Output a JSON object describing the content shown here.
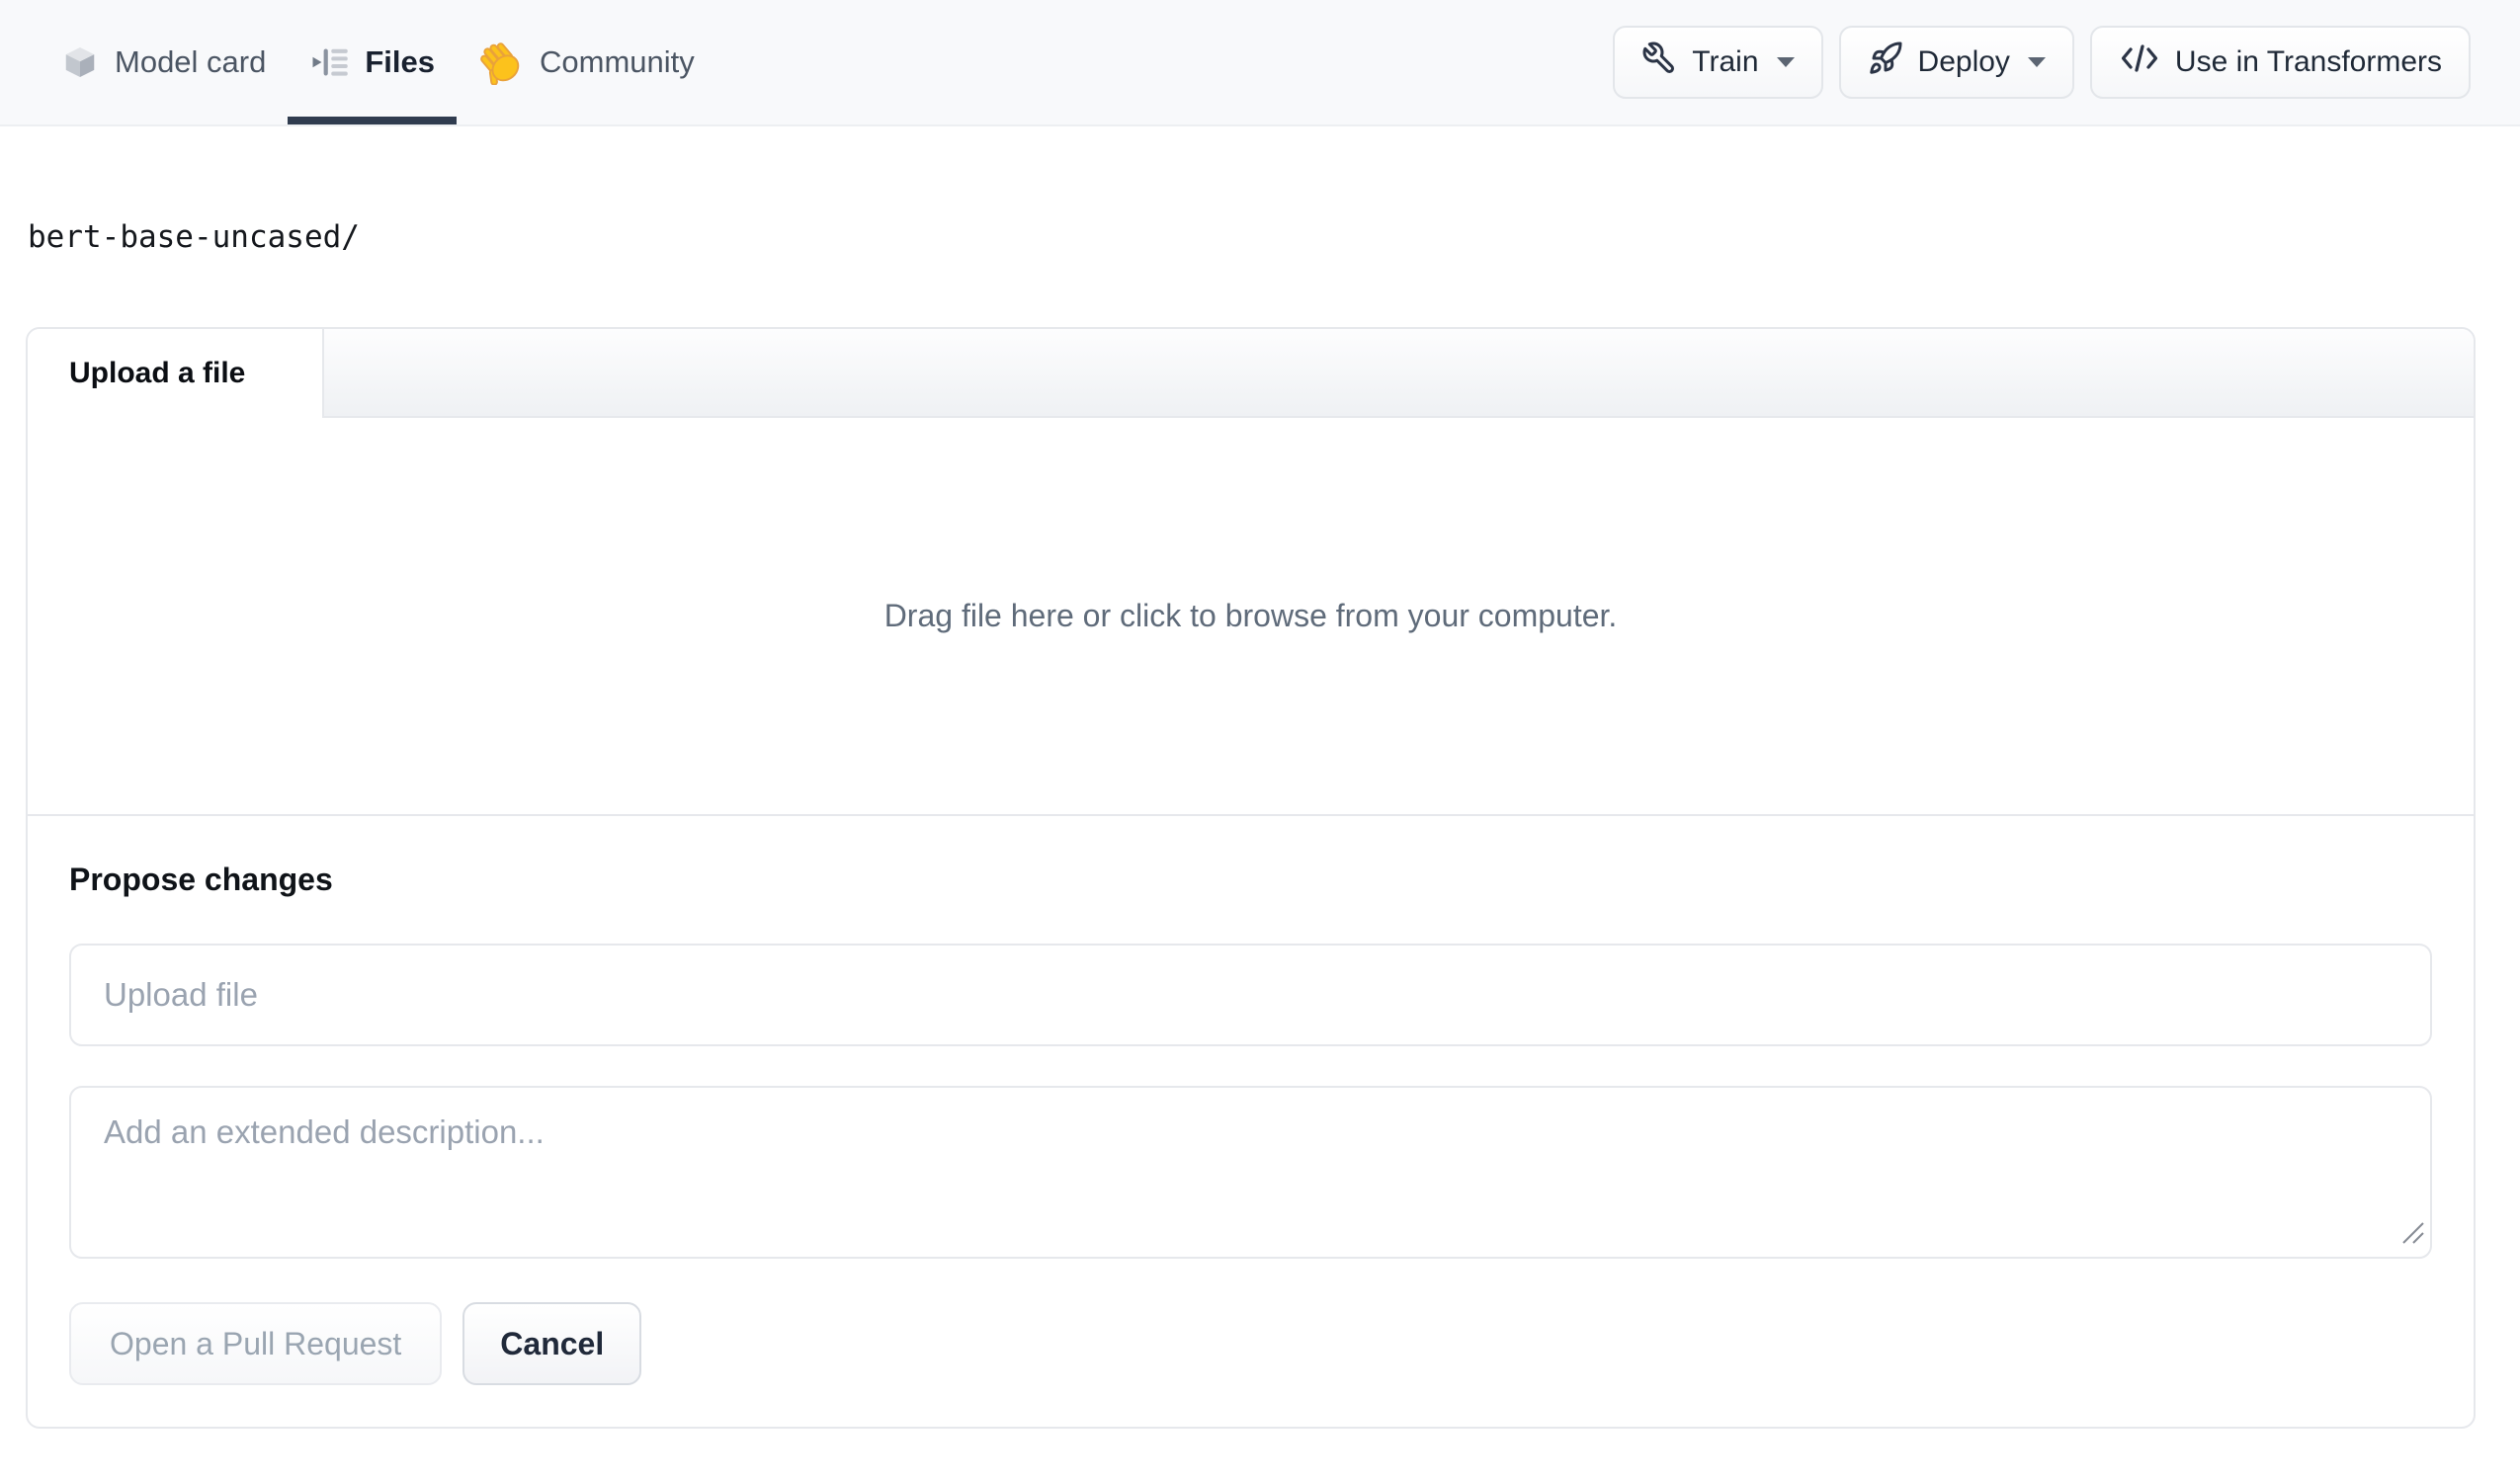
{
  "colors": {
    "accent_underline": "#303c4f",
    "nav_background": "#f8f9fb",
    "panel_border": "#e6e8ec",
    "community_hand_yellow": "#fcc21c",
    "disabled_text": "#9aa5b1"
  },
  "nav": {
    "tabs": [
      {
        "label": "Model card",
        "icon": "model-card-cube-icon",
        "active": false
      },
      {
        "label": "Files",
        "icon": "files-list-icon",
        "active": true
      },
      {
        "label": "Community",
        "icon": "waving-hand-icon",
        "active": false
      }
    ],
    "actions": [
      {
        "label": "Train",
        "icon": "wrench-icon",
        "has_caret": true
      },
      {
        "label": "Deploy",
        "icon": "rocket-icon",
        "has_caret": true
      },
      {
        "label": "Use in Transformers",
        "icon": "code-icon",
        "has_caret": false
      }
    ]
  },
  "breadcrumb": {
    "path": "bert-base-uncased/"
  },
  "upload_panel": {
    "tab_label": "Upload a file",
    "dropzone_text": "Drag file here or click to browse from your computer.",
    "propose_heading": "Propose changes",
    "filename_placeholder": "Upload file",
    "description_placeholder": "Add an extended description...",
    "open_pr_label": "Open a Pull Request",
    "cancel_label": "Cancel"
  }
}
